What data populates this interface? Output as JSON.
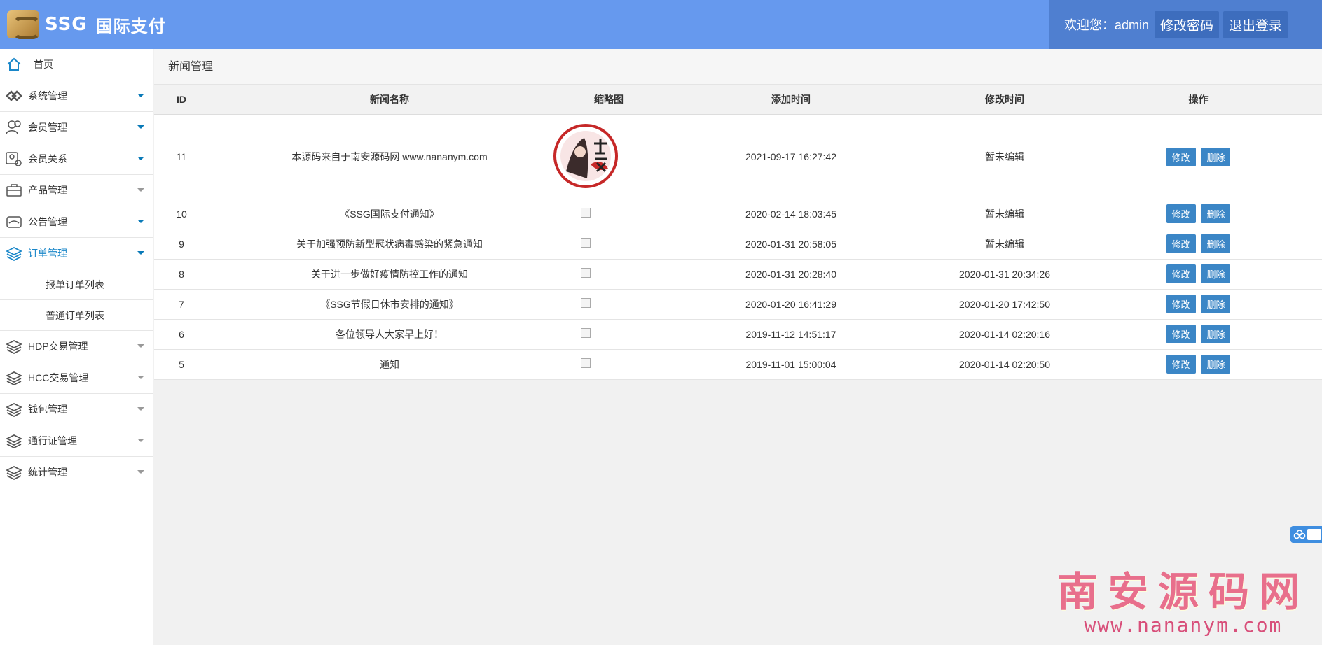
{
  "header": {
    "brand": "SSG",
    "brand_cn": "国际支付",
    "welcome": "欢迎您：admin",
    "change_password": "修改密码",
    "logout": "退出登录"
  },
  "sidebar": {
    "items": [
      {
        "label": "首页",
        "icon": "home-icon"
      },
      {
        "label": "系统管理",
        "icon": "system-icon"
      },
      {
        "label": "会员管理",
        "icon": "users-icon"
      },
      {
        "label": "会员关系",
        "icon": "relation-icon"
      },
      {
        "label": "产品管理",
        "icon": "briefcase-icon"
      },
      {
        "label": "公告管理",
        "icon": "notice-icon"
      },
      {
        "label": "订单管理",
        "icon": "order-icon"
      },
      {
        "label": "HDP交易管理",
        "icon": "coins-icon"
      },
      {
        "label": "HCC交易管理",
        "icon": "coins-icon"
      },
      {
        "label": "钱包管理",
        "icon": "coins-icon"
      },
      {
        "label": "通行证管理",
        "icon": "coins-icon"
      },
      {
        "label": "统计管理",
        "icon": "coins-icon"
      }
    ],
    "sub_items": [
      {
        "label": "报单订单列表"
      },
      {
        "label": "普通订单列表"
      }
    ]
  },
  "page": {
    "title": "新闻管理"
  },
  "table": {
    "headers": [
      "ID",
      "新闻名称",
      "缩略图",
      "添加时间",
      "修改时间",
      "操作"
    ],
    "edit_label": "修改",
    "delete_label": "删除",
    "rows": [
      {
        "id": "11",
        "name": "本源码来自于南安源码网 www.nananym.com",
        "added": "2021-09-17 16:27:42",
        "modified": "暂未编辑",
        "thumb": "image"
      },
      {
        "id": "10",
        "name": "《SSG国际支付通知》",
        "added": "2020-02-14 18:03:45",
        "modified": "暂未编辑",
        "thumb": "broken"
      },
      {
        "id": "9",
        "name": "关于加强预防新型冠状病毒感染的紧急通知",
        "added": "2020-01-31 20:58:05",
        "modified": "暂未编辑",
        "thumb": "broken"
      },
      {
        "id": "8",
        "name": "关于进一步做好疫情防控工作的通知",
        "added": "2020-01-31 20:28:40",
        "modified": "2020-01-31 20:34:26",
        "thumb": "broken"
      },
      {
        "id": "7",
        "name": "《SSG节假日休市安排的通知》",
        "added": "2020-01-20 16:41:29",
        "modified": "2020-01-20 17:42:50",
        "thumb": "broken"
      },
      {
        "id": "6",
        "name": "各位领导人大家早上好！",
        "added": "2019-11-12 14:51:17",
        "modified": "2020-01-14 02:20:16",
        "thumb": "broken"
      },
      {
        "id": "5",
        "name": "通知",
        "added": "2019-11-01 15:00:04",
        "modified": "2020-01-14 02:20:50",
        "thumb": "broken"
      }
    ]
  },
  "watermark": {
    "line1": "南安源码网",
    "line2": "www.nananym.com"
  },
  "colors": {
    "header": "#6699ee",
    "header_right": "#4f7fd0",
    "button": "#3b86c6",
    "active": "#1a87c9"
  }
}
